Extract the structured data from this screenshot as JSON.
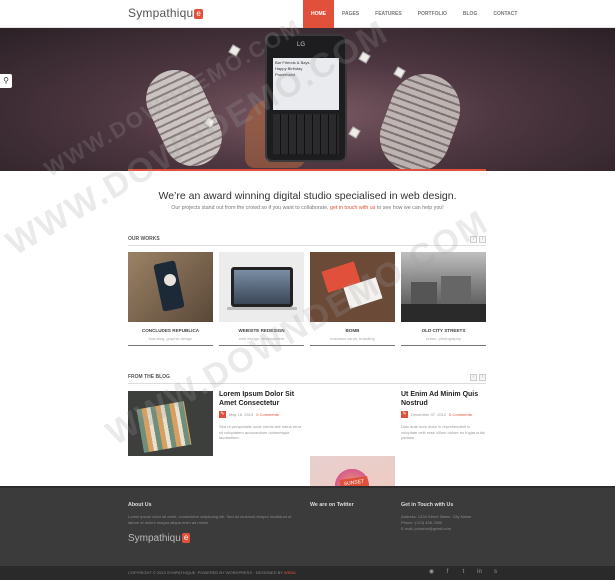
{
  "header": {
    "logo_text": "Sympathiqu",
    "logo_mark": "e",
    "nav": [
      "HOME",
      "PAGES",
      "FEATURES",
      "PORTFOLIO",
      "BLOG",
      "CONTACT"
    ],
    "active_nav": "HOME"
  },
  "hero": {
    "phone_brand": "LG",
    "screen_lines": [
      "Bar Friends & Bays",
      "Happy Birthday",
      "Powerband"
    ]
  },
  "intro": {
    "title": "We’re an award winning digital studio specialised in web design.",
    "text_before": "Our projects stand out from the crowd so if you want to collaborate,",
    "link": "get in touch with us",
    "text_after": "to see how we can help you!"
  },
  "works": {
    "title": "OUR WORKS",
    "prev": "‹",
    "next": "›",
    "items": [
      {
        "title": "CONCLUDES REPUBLICA",
        "subtitle": "branding, graphic design"
      },
      {
        "title": "WEBSITE REDESIGN",
        "subtitle": "web design, development"
      },
      {
        "title": "BOMB",
        "subtitle": "business cards, branding"
      },
      {
        "title": "OLD CITY STREETS",
        "subtitle": "urban, photography"
      }
    ]
  },
  "blog": {
    "title": "FROM THE BLOG",
    "prev": "‹",
    "next": "›",
    "posts": [
      {
        "title": "Lorem Ipsum Dolor Sit Amet Consectetur",
        "date": "May 16, 2013",
        "comments": "0 Comments",
        "excerpt": "Sed ut perspiciatis unde omnis iste natus error sit voluptatem accusantium doloremque laudantium."
      },
      {
        "title": "Ut Enim Ad Minim Quis Nostrud",
        "date": "December 07, 2012",
        "comments": "0 Comments",
        "excerpt": "Duis aute irure dolor in reprehenderit in voluptate velit esse cillum dolore eu fugiat nulla pariatur."
      }
    ]
  },
  "footer": {
    "about_title": "About Us",
    "about_text": "Lorem ipsum dolor sit amet, consectetur adipiscing elit. Sed do eiusmod tempor incididunt ut labore et dolore magna aliqua enim ad minim.",
    "twitter_title": "We are on Twitter",
    "contact_title": "Get in Touch with Us",
    "contact_lines": [
      "Address: 1234 Street Name, City Name",
      "Phone: (123) 456-7890",
      "E-mail: johndoe@gmail.com"
    ],
    "logo_text": "Sympathiqu",
    "logo_mark": "e",
    "copyright": "COPYRIGHT © 2013 SYMPATHIQUE. POWERED BY WORDPRESS · DESIGNED BY",
    "copyright_link": "WEBA"
  }
}
